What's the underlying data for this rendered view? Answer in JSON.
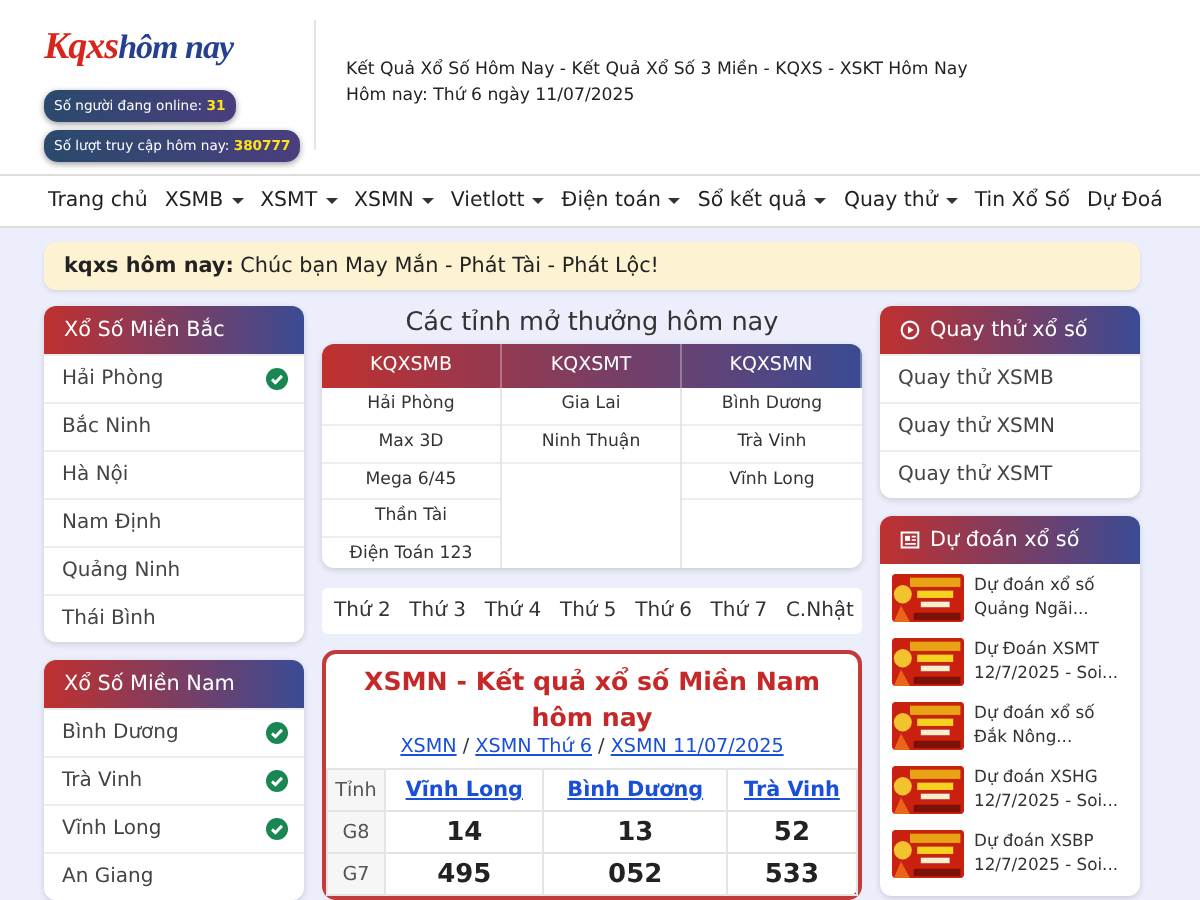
{
  "header": {
    "logo": {
      "brand": "Kqxs",
      "tagline": "hôm nay"
    },
    "stats": [
      {
        "label": "Số người đang online:",
        "value": "31"
      },
      {
        "label": "Số lượt truy cập hôm nay:",
        "value": "380777"
      }
    ],
    "title": "Kết Quả Xổ Số Hôm Nay - Kết Quả Xổ Số 3 Miền - KQXS - XSKT Hôm Nay",
    "date": "Hôm nay: Thứ 6 ngày 11/07/2025"
  },
  "nav": [
    {
      "label": "Trang chủ",
      "dropdown": false
    },
    {
      "label": "XSMB",
      "dropdown": true
    },
    {
      "label": "XSMT",
      "dropdown": true
    },
    {
      "label": "XSMN",
      "dropdown": true
    },
    {
      "label": "Vietlott",
      "dropdown": true
    },
    {
      "label": "Điện toán",
      "dropdown": true
    },
    {
      "label": "Sổ kết quả",
      "dropdown": true
    },
    {
      "label": "Quay thử",
      "dropdown": true
    },
    {
      "label": "Tin Xổ Số",
      "dropdown": false
    },
    {
      "label": "Dự Đoá",
      "dropdown": false
    }
  ],
  "notice": "**kqxs hôm nay:** Chúc bạn May Mắn - Phát Tài - Phát Lộc!",
  "left_panels": [
    {
      "title": "Xổ Số Miền Bắc",
      "items": [
        {
          "label": "Hải Phòng",
          "checked": true
        },
        {
          "label": "Bắc Ninh",
          "checked": false
        },
        {
          "label": "Hà Nội",
          "checked": false
        },
        {
          "label": "Nam Định",
          "checked": false
        },
        {
          "label": "Quảng Ninh",
          "checked": false
        },
        {
          "label": "Thái Bình",
          "checked": false
        }
      ]
    },
    {
      "title": "Xổ Số Miền Nam",
      "items": [
        {
          "label": "Bình Dương",
          "checked": true
        },
        {
          "label": "Trà Vinh",
          "checked": true
        },
        {
          "label": "Vĩnh Long",
          "checked": true
        },
        {
          "label": "An Giang",
          "checked": false
        }
      ]
    }
  ],
  "open_today": {
    "title": "Các tỉnh mở thưởng hôm nay",
    "columns": [
      {
        "heading": "KQXSMB",
        "items": [
          "Hải Phòng",
          "Max 3D",
          "Mega 6/45",
          "Thần Tài",
          "Điện Toán 123"
        ]
      },
      {
        "heading": "KQXSMT",
        "items": [
          "Gia Lai",
          "Ninh Thuận"
        ]
      },
      {
        "heading": "KQXSMN",
        "items": [
          "Bình Dương",
          "Trà Vinh",
          "Vĩnh Long"
        ]
      }
    ]
  },
  "days": [
    "Thứ 2",
    "Thứ 3",
    "Thứ 4",
    "Thứ 5",
    "Thứ 6",
    "Thứ 7",
    "C.Nhật"
  ],
  "result": {
    "title": "XSMN - Kết quả xổ số Miền Nam hôm nay",
    "breadcrumb": {
      "separator": "/",
      "links": [
        "XSMN",
        "XSMN Thứ 6",
        "XSMN 11/07/2025"
      ]
    },
    "columns": [
      "Tỉnh",
      "Vĩnh Long",
      "Bình Dương",
      "Trà Vinh"
    ],
    "rows": [
      {
        "prize": "G8",
        "values": [
          "14",
          "13",
          "52"
        ]
      },
      {
        "prize": "G7",
        "values": [
          "495",
          "052",
          "533"
        ]
      }
    ]
  },
  "right_panels": [
    {
      "title": "Quay thử xổ số",
      "kind": "links",
      "items": [
        {
          "text": "Quay thử XSMB"
        },
        {
          "text": "Quay thử XSMN"
        },
        {
          "text": "Quay thử XSMT"
        }
      ]
    },
    {
      "title": "Dự đoán xổ số",
      "kind": "articles",
      "items": [
        {
          "kind": "picture",
          "text": "Dự đoán xổ số Quảng Ngãi..."
        },
        {
          "kind": "picture",
          "text": "Dự Đoán XSMT 12/7/2025 - Soi..."
        },
        {
          "kind": "picture",
          "text": "Dự đoán xổ số Đắk Nông..."
        },
        {
          "kind": "picture",
          "text": "Dự đoán XSHG 12/7/2025 - Soi..."
        },
        {
          "kind": "picture",
          "text": "Dự đoán XSBP 12/7/2025 - Soi..."
        }
      ]
    }
  ]
}
